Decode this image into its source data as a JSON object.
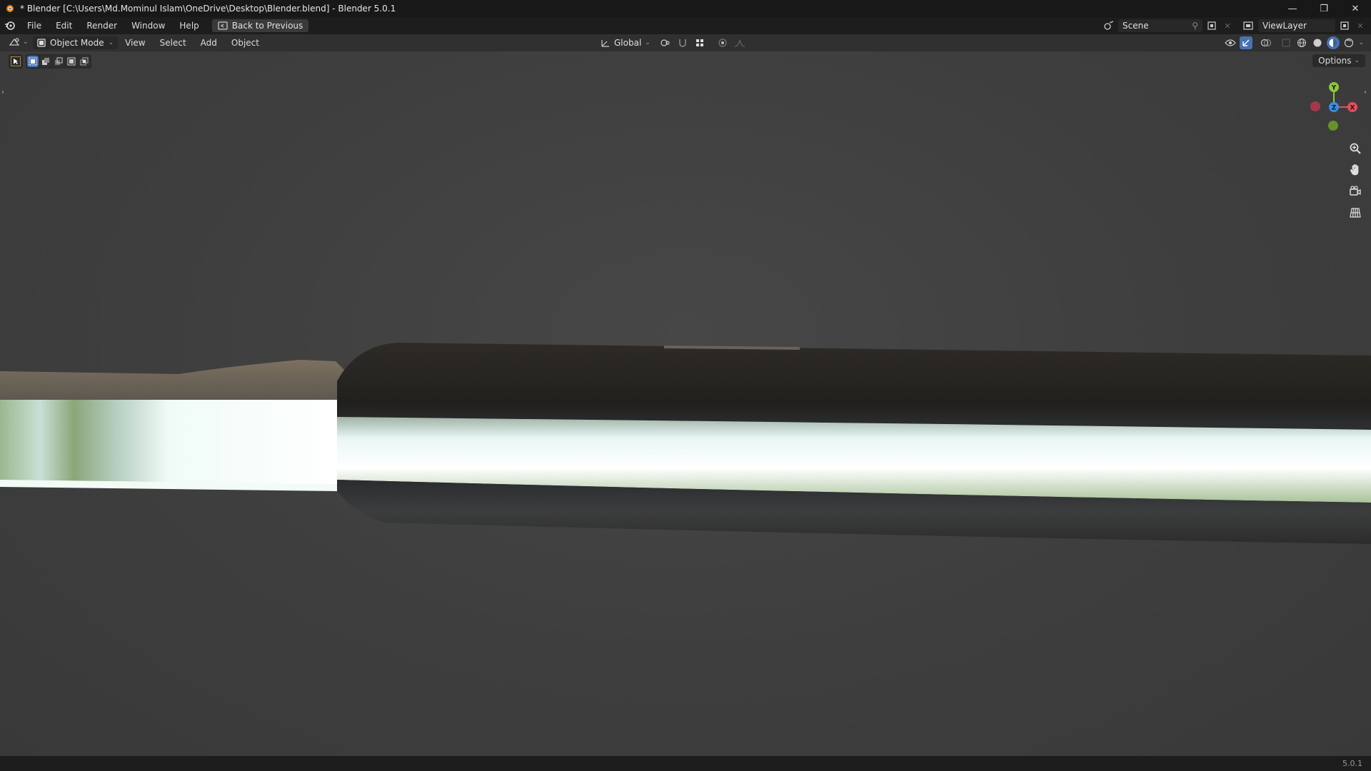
{
  "window": {
    "title": "* Blender [C:\\Users\\Md.Mominul Islam\\OneDrive\\Desktop\\Blender.blend] - Blender 5.0.1",
    "minimize": "—",
    "restore": "❐",
    "close": "✕"
  },
  "topbar": {
    "menus": [
      "File",
      "Edit",
      "Render",
      "Window",
      "Help"
    ],
    "back_button": "Back to Previous",
    "scene": "Scene",
    "view_layer": "ViewLayer"
  },
  "header": {
    "mode": "Object Mode",
    "menus": [
      "View",
      "Select",
      "Add",
      "Object"
    ],
    "transform_orientation": "Global"
  },
  "viewport": {
    "options_label": "Options",
    "gizmo": {
      "x": "X",
      "y": "Y",
      "z": "Z"
    }
  },
  "statusbar": {
    "version": "5.0.1"
  },
  "colors": {
    "accent_blue": "#4772b3",
    "axis_x": "#e74c5c",
    "axis_y": "#8fc63d",
    "axis_z": "#3a8ee6"
  }
}
